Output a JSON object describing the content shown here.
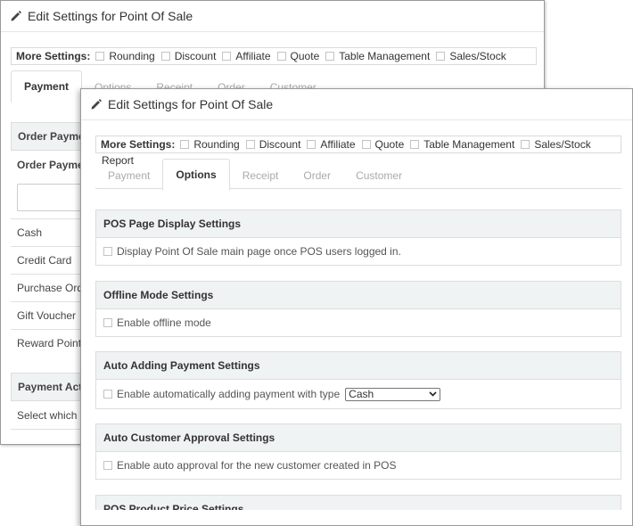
{
  "back_window": {
    "title": "Edit Settings for Point Of Sale",
    "more_settings": {
      "label": "More Settings:",
      "options": [
        "Rounding",
        "Discount",
        "Affiliate",
        "Quote",
        "Table Management",
        "Sales/Stock"
      ]
    },
    "tabs": [
      "Payment",
      "Options",
      "Receipt",
      "Order",
      "Customer"
    ],
    "active_tab": "Payment",
    "order_payment_header": "Order Payme",
    "order_payment_subheader": "Order Payme",
    "payment_methods": [
      "Cash",
      "Credit Card",
      "Purchase Ord",
      "Gift Voucher",
      "Reward Point"
    ],
    "payment_action_header": "Payment Act",
    "payment_action_text": "Select which"
  },
  "front_window": {
    "title": "Edit Settings for Point Of Sale",
    "more_settings": {
      "label": "More Settings:",
      "options": [
        "Rounding",
        "Discount",
        "Affiliate",
        "Quote",
        "Table Management",
        "Sales/Stock"
      ],
      "overflow": "Report"
    },
    "tabs": [
      "Payment",
      "Options",
      "Receipt",
      "Order",
      "Customer"
    ],
    "active_tab": "Options",
    "sections": [
      {
        "header": "POS Page Display Settings",
        "option": "Display Point Of Sale main page once POS users logged in."
      },
      {
        "header": "Offline Mode Settings",
        "option": "Enable offline mode"
      },
      {
        "header": "Auto Adding Payment Settings",
        "option": "Enable automatically adding payment with type",
        "select_value": "Cash"
      },
      {
        "header": "Auto Customer Approval Settings",
        "option": "Enable auto approval for the new customer created in POS"
      },
      {
        "header": "POS Product Price Settings"
      }
    ]
  }
}
